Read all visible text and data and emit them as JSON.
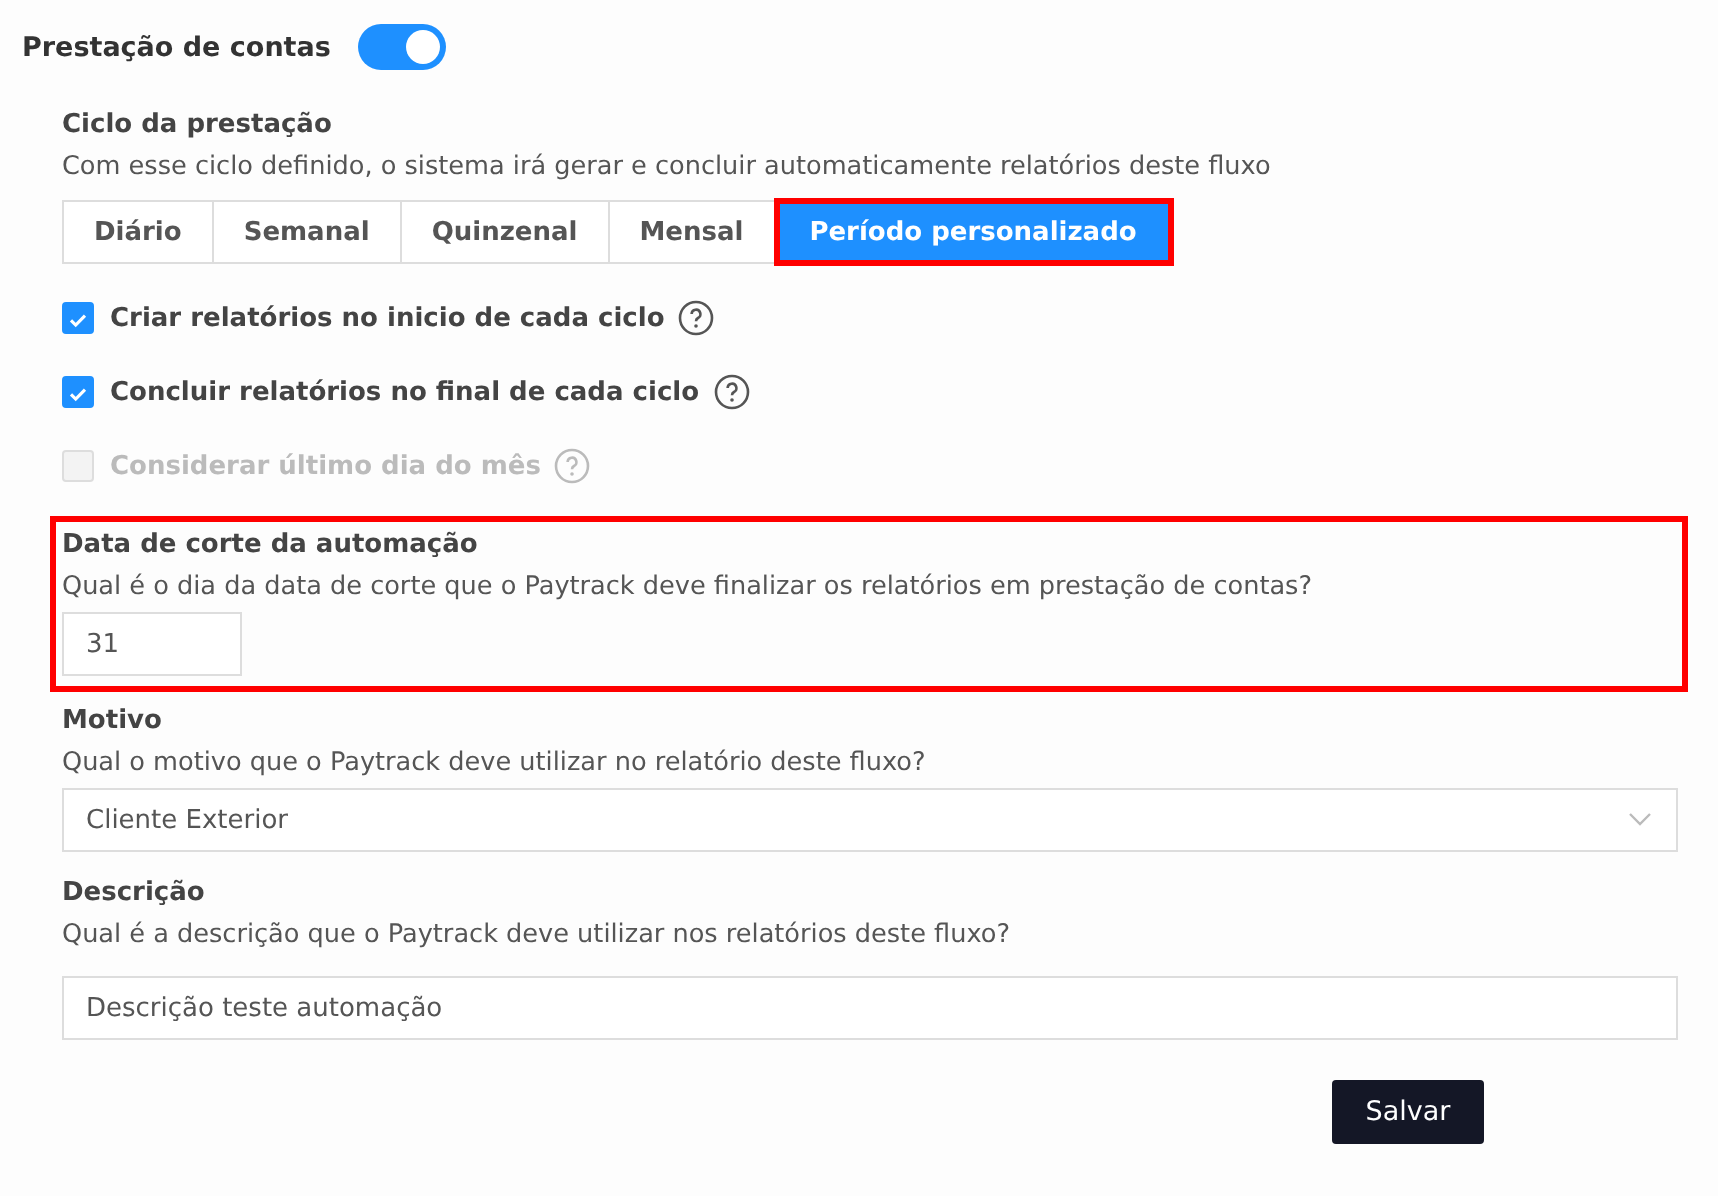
{
  "header": {
    "title": "Prestação de contas",
    "on": true
  },
  "cycle": {
    "title": "Ciclo da prestação",
    "description": "Com esse ciclo definido, o sistema irá gerar e concluir automaticamente relatórios deste fluxo",
    "tabs": [
      {
        "label": "Diário",
        "selected": false,
        "highlighted": false
      },
      {
        "label": "Semanal",
        "selected": false,
        "highlighted": false
      },
      {
        "label": "Quinzenal",
        "selected": false,
        "highlighted": false
      },
      {
        "label": "Mensal",
        "selected": false,
        "highlighted": false
      },
      {
        "label": "Período personalizado",
        "selected": true,
        "highlighted": true
      }
    ]
  },
  "options": [
    {
      "label": "Criar relatórios no inicio de cada ciclo",
      "checked": true,
      "disabled": false
    },
    {
      "label": "Concluir relatórios no final de cada ciclo",
      "checked": true,
      "disabled": false
    },
    {
      "label": "Considerar último dia do mês",
      "checked": false,
      "disabled": true
    }
  ],
  "fields": [
    {
      "kind": "short",
      "title": "Data de corte da automação",
      "question": "Qual é o dia da data de corte que o Paytrack deve finalizar os relatórios em prestação de contas?",
      "value": "31",
      "highlighted": true
    },
    {
      "kind": "select",
      "title": "Motivo",
      "question": "Qual o motivo que o Paytrack deve utilizar no relatório deste fluxo?",
      "value": "Cliente Exterior",
      "highlighted": false
    },
    {
      "kind": "text",
      "title": "Descrição",
      "question": "Qual é a descrição que o Paytrack deve utilizar nos relatórios deste fluxo?",
      "value": "Descrição teste automação",
      "highlighted": false
    }
  ],
  "save_button": "Salvar"
}
